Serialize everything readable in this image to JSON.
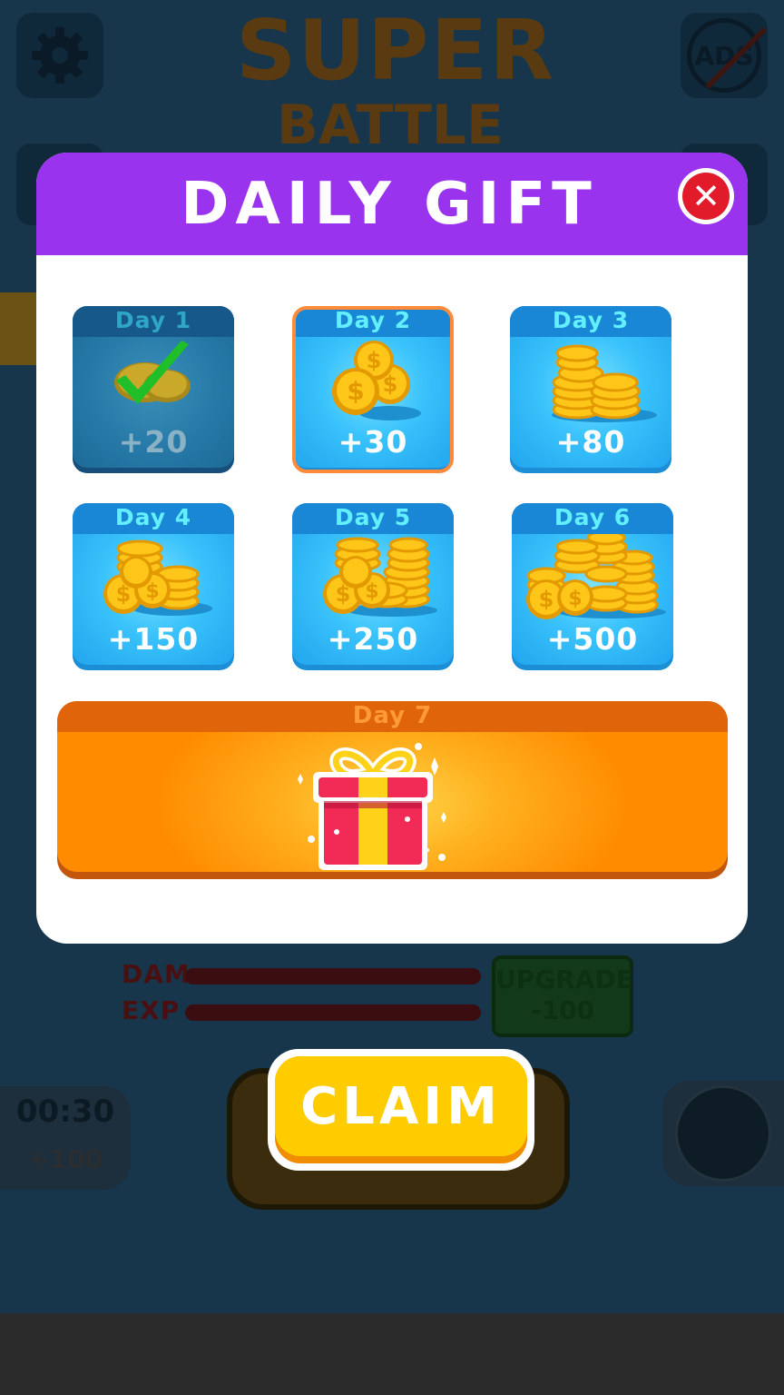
{
  "background": {
    "title_line1": "SUPER",
    "title_line2": "BATTLE",
    "ads_label": "ADS",
    "stats": [
      {
        "label": "DAM"
      },
      {
        "label": "EXP"
      }
    ],
    "upgrade": {
      "label": "UPGRADE",
      "cost": "-100"
    },
    "timer": {
      "time": "00:30",
      "reward": "+100"
    }
  },
  "modal": {
    "title": "DAILY GIFT",
    "close_icon": "close-x",
    "days": [
      {
        "label": "Day 1",
        "amount": "+20",
        "state": "claimed",
        "icon": "coins-checkmark"
      },
      {
        "label": "Day 2",
        "amount": "+30",
        "state": "current",
        "icon": "coins-small"
      },
      {
        "label": "Day 3",
        "amount": "+80",
        "state": "locked",
        "icon": "coin-stack-small"
      },
      {
        "label": "Day 4",
        "amount": "+150",
        "state": "locked",
        "icon": "coin-pile"
      },
      {
        "label": "Day 5",
        "amount": "+250",
        "state": "locked",
        "icon": "coin-pile-large"
      },
      {
        "label": "Day 6",
        "amount": "+500",
        "state": "locked",
        "icon": "coin-pile-huge"
      }
    ],
    "day7": {
      "label": "Day 7",
      "icon": "gift-box"
    }
  },
  "claim_button": {
    "label": "CLAIM"
  },
  "colors": {
    "header_purple": "#9933ee",
    "card_blue": "#39c2fb",
    "day7_orange": "#ff8c00",
    "claim_yellow": "#ffcc00",
    "close_red": "#e11b2a"
  }
}
